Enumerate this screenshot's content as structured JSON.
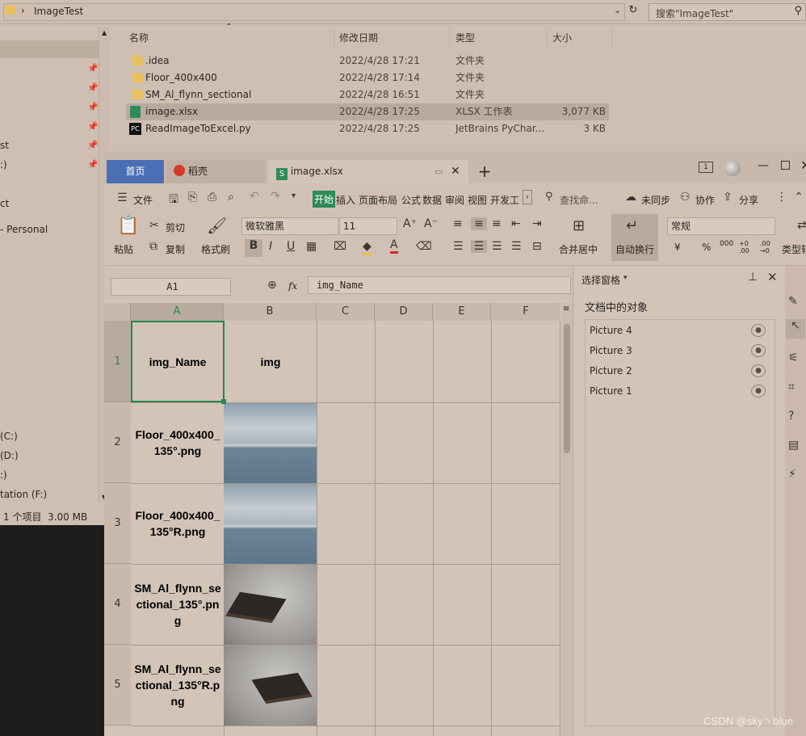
{
  "explorer": {
    "address": "ImageTest",
    "search_placeholder": "搜索\"ImageTest\"",
    "nav": [
      {
        "label": "",
        "pinned": false
      },
      {
        "label": "",
        "pinned": true
      },
      {
        "label": "",
        "pinned": true
      },
      {
        "label": "",
        "pinned": true
      },
      {
        "label": "",
        "pinned": true
      },
      {
        "label": "st",
        "pinned": true
      },
      {
        "label": ":)",
        "pinned": true
      },
      {
        "label": "ct",
        "pinned": false
      },
      {
        "label": "- Personal",
        "pinned": false
      },
      {
        "label": "(C:)",
        "pinned": false
      },
      {
        "label": "(D:)",
        "pinned": false
      },
      {
        "label": ":)",
        "pinned": false
      },
      {
        "label": "tation (F:)",
        "pinned": false
      }
    ],
    "status": "1 个项目  3.00 MB",
    "columns": {
      "name": "名称",
      "date": "修改日期",
      "type": "类型",
      "size": "大小"
    },
    "files": [
      {
        "name": ".idea",
        "date": "2022/4/28 17:21",
        "type": "文件夹",
        "size": "",
        "icon": "folder-icon"
      },
      {
        "name": "Floor_400x400",
        "date": "2022/4/28 17:14",
        "type": "文件夹",
        "size": "",
        "icon": "folder-icon"
      },
      {
        "name": "SM_Al_flynn_sectional",
        "date": "2022/4/28 16:51",
        "type": "文件夹",
        "size": "",
        "icon": "folder-icon"
      },
      {
        "name": "image.xlsx",
        "date": "2022/4/28 17:25",
        "type": "XLSX 工作表",
        "size": "3,077 KB",
        "icon": "xlsx-icon"
      },
      {
        "name": "ReadImageToExcel.py",
        "date": "2022/4/28 17:25",
        "type": "JetBrains PyChar...",
        "size": "3 KB",
        "icon": "pycharm-icon"
      }
    ]
  },
  "wps": {
    "tabs": {
      "home": "首页",
      "daoke": "稻壳",
      "file": "image.xlsx",
      "add": "+"
    },
    "menu": {
      "file": "文件",
      "start": "开始",
      "insert": "插入",
      "layout": "页面布局",
      "formula": "公式",
      "data": "数据",
      "review": "审阅",
      "view": "视图",
      "dev": "开发工",
      "search": "查找命...",
      "sync": "未同步",
      "collab": "协作",
      "share": "分享"
    },
    "ribbon": {
      "paste": "粘贴",
      "cut": "剪切",
      "copy": "复制",
      "format_painter": "格式刷",
      "font": "微软雅黑",
      "size": "11",
      "merge": "合并居中",
      "wrap": "自动换行",
      "number_format": "常规",
      "currency": "¥",
      "percent": "%",
      "thousands": "000",
      "dec_inc": "+0 .00",
      "dec_dec": ".00 →0",
      "types": "类型转"
    },
    "cell_ref": "A1",
    "fx": "fx",
    "formula": "img_Name",
    "columns": [
      "A",
      "B",
      "C",
      "D",
      "E",
      "F"
    ],
    "rows": [
      {
        "num": "1",
        "a": "img_Name",
        "b": "img",
        "image": ""
      },
      {
        "num": "2",
        "a": "Floor_400x400_135°.png",
        "b": "",
        "image": "sky"
      },
      {
        "num": "3",
        "a": "Floor_400x400_135°R.png",
        "b": "",
        "image": "sky"
      },
      {
        "num": "4",
        "a": "SM_Al_flynn_sectional_135°.png",
        "b": "",
        "image": "sofa"
      },
      {
        "num": "5",
        "a": "SM_Al_flynn_sectional_135°R.png",
        "b": "",
        "image": "sofa"
      }
    ],
    "panel": {
      "title": "选择窗格",
      "subtitle": "文档中的对象",
      "items": [
        "Picture 4",
        "Picture 3",
        "Picture 2",
        "Picture 1"
      ]
    }
  },
  "watermark": "CSDN @sky丶blue",
  "colors": {
    "selection": "#1f8a4c",
    "start_tab": "#2e8b57",
    "home_tab": "#4a6fb5"
  }
}
